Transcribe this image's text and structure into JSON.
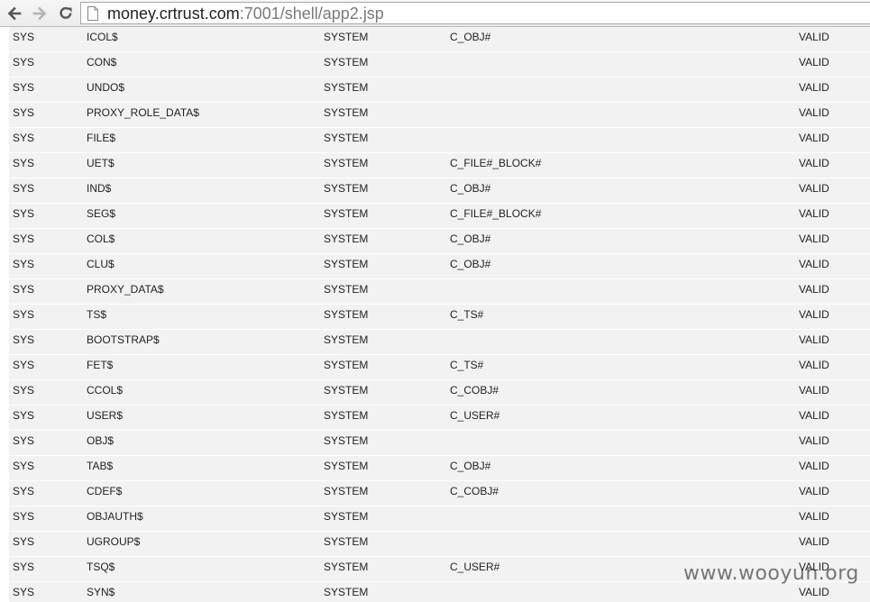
{
  "browser": {
    "url_host": "money.crtrust.com",
    "url_rest": ":7001/shell/app2.jsp",
    "icons": {
      "back": "back-arrow-icon",
      "forward": "forward-arrow-icon",
      "reload": "reload-icon",
      "page": "page-icon"
    }
  },
  "table": {
    "rows": [
      {
        "owner": "SYS",
        "name": "ICOL$",
        "tablespace": "SYSTEM",
        "cluster": "C_OBJ#",
        "status": "VALID"
      },
      {
        "owner": "SYS",
        "name": "CON$",
        "tablespace": "SYSTEM",
        "cluster": "",
        "status": "VALID"
      },
      {
        "owner": "SYS",
        "name": "UNDO$",
        "tablespace": "SYSTEM",
        "cluster": "",
        "status": "VALID"
      },
      {
        "owner": "SYS",
        "name": "PROXY_ROLE_DATA$",
        "tablespace": "SYSTEM",
        "cluster": "",
        "status": "VALID"
      },
      {
        "owner": "SYS",
        "name": "FILE$",
        "tablespace": "SYSTEM",
        "cluster": "",
        "status": "VALID"
      },
      {
        "owner": "SYS",
        "name": "UET$",
        "tablespace": "SYSTEM",
        "cluster": "C_FILE#_BLOCK#",
        "status": "VALID"
      },
      {
        "owner": "SYS",
        "name": "IND$",
        "tablespace": "SYSTEM",
        "cluster": "C_OBJ#",
        "status": "VALID"
      },
      {
        "owner": "SYS",
        "name": "SEG$",
        "tablespace": "SYSTEM",
        "cluster": "C_FILE#_BLOCK#",
        "status": "VALID"
      },
      {
        "owner": "SYS",
        "name": "COL$",
        "tablespace": "SYSTEM",
        "cluster": "C_OBJ#",
        "status": "VALID"
      },
      {
        "owner": "SYS",
        "name": "CLU$",
        "tablespace": "SYSTEM",
        "cluster": "C_OBJ#",
        "status": "VALID"
      },
      {
        "owner": "SYS",
        "name": "PROXY_DATA$",
        "tablespace": "SYSTEM",
        "cluster": "",
        "status": "VALID"
      },
      {
        "owner": "SYS",
        "name": "TS$",
        "tablespace": "SYSTEM",
        "cluster": "C_TS#",
        "status": "VALID"
      },
      {
        "owner": "SYS",
        "name": "BOOTSTRAP$",
        "tablespace": "SYSTEM",
        "cluster": "",
        "status": "VALID"
      },
      {
        "owner": "SYS",
        "name": "FET$",
        "tablespace": "SYSTEM",
        "cluster": "C_TS#",
        "status": "VALID"
      },
      {
        "owner": "SYS",
        "name": "CCOL$",
        "tablespace": "SYSTEM",
        "cluster": "C_COBJ#",
        "status": "VALID"
      },
      {
        "owner": "SYS",
        "name": "USER$",
        "tablespace": "SYSTEM",
        "cluster": "C_USER#",
        "status": "VALID"
      },
      {
        "owner": "SYS",
        "name": "OBJ$",
        "tablespace": "SYSTEM",
        "cluster": "",
        "status": "VALID"
      },
      {
        "owner": "SYS",
        "name": "TAB$",
        "tablespace": "SYSTEM",
        "cluster": "C_OBJ#",
        "status": "VALID"
      },
      {
        "owner": "SYS",
        "name": "CDEF$",
        "tablespace": "SYSTEM",
        "cluster": "C_COBJ#",
        "status": "VALID"
      },
      {
        "owner": "SYS",
        "name": "OBJAUTH$",
        "tablespace": "SYSTEM",
        "cluster": "",
        "status": "VALID"
      },
      {
        "owner": "SYS",
        "name": "UGROUP$",
        "tablespace": "SYSTEM",
        "cluster": "",
        "status": "VALID"
      },
      {
        "owner": "SYS",
        "name": "TSQ$",
        "tablespace": "SYSTEM",
        "cluster": "C_USER#",
        "status": "VALID"
      },
      {
        "owner": "SYS",
        "name": "SYN$",
        "tablespace": "SYSTEM",
        "cluster": "",
        "status": "VALID"
      }
    ]
  },
  "watermark": "www.wooyun.org"
}
